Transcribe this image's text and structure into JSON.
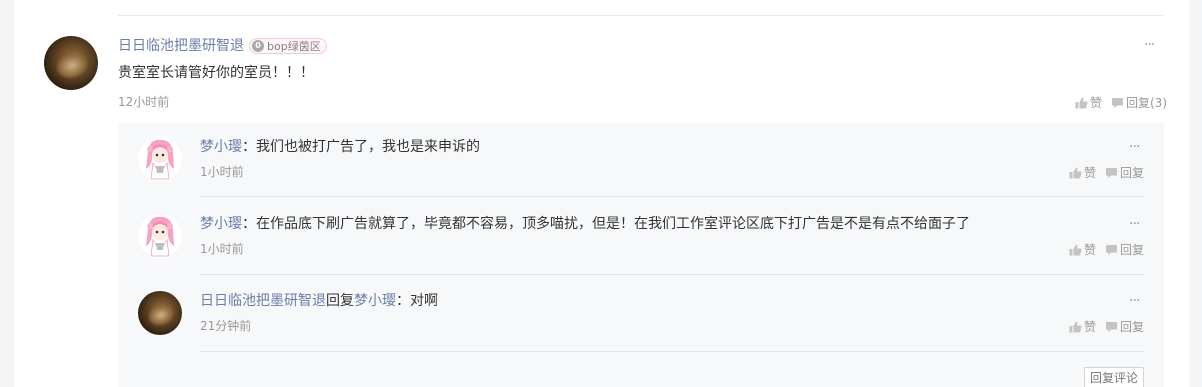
{
  "main_comment": {
    "author": "日日临池把墨研智退",
    "badge": "bop绿茵区",
    "badge_coin": "0",
    "text": "贵室室长请管好你的室员！！！",
    "time": "12小时前",
    "like_label": "赞",
    "reply_label": "回复(3)",
    "more": "···"
  },
  "replies": [
    {
      "author": "梦小璎",
      "separator": "：",
      "text": "我们也被打广告了，我也是来申诉的",
      "time": "1小时前",
      "like_label": "赞",
      "reply_label": "回复",
      "more": "···"
    },
    {
      "author": "梦小璎",
      "separator": "：",
      "text": "在作品底下刷广告就算了，毕竟都不容易，顶多喵扰，但是！在我们工作室评论区底下打广告是不是有点不给面子了",
      "time": "1小时前",
      "like_label": "赞",
      "reply_label": "回复",
      "more": "···"
    },
    {
      "author": "日日临池把墨研智退",
      "reply_word": "回复",
      "target": "梦小璎",
      "separator": "：",
      "text": "对啊",
      "time": "21分钟前",
      "like_label": "赞",
      "reply_label": "回复",
      "more": "···"
    }
  ],
  "reply_comment_button": "回复评论",
  "colors": {
    "username": "#6b7fa6",
    "reply_background": "#f7f8fa",
    "muted": "#999999"
  }
}
